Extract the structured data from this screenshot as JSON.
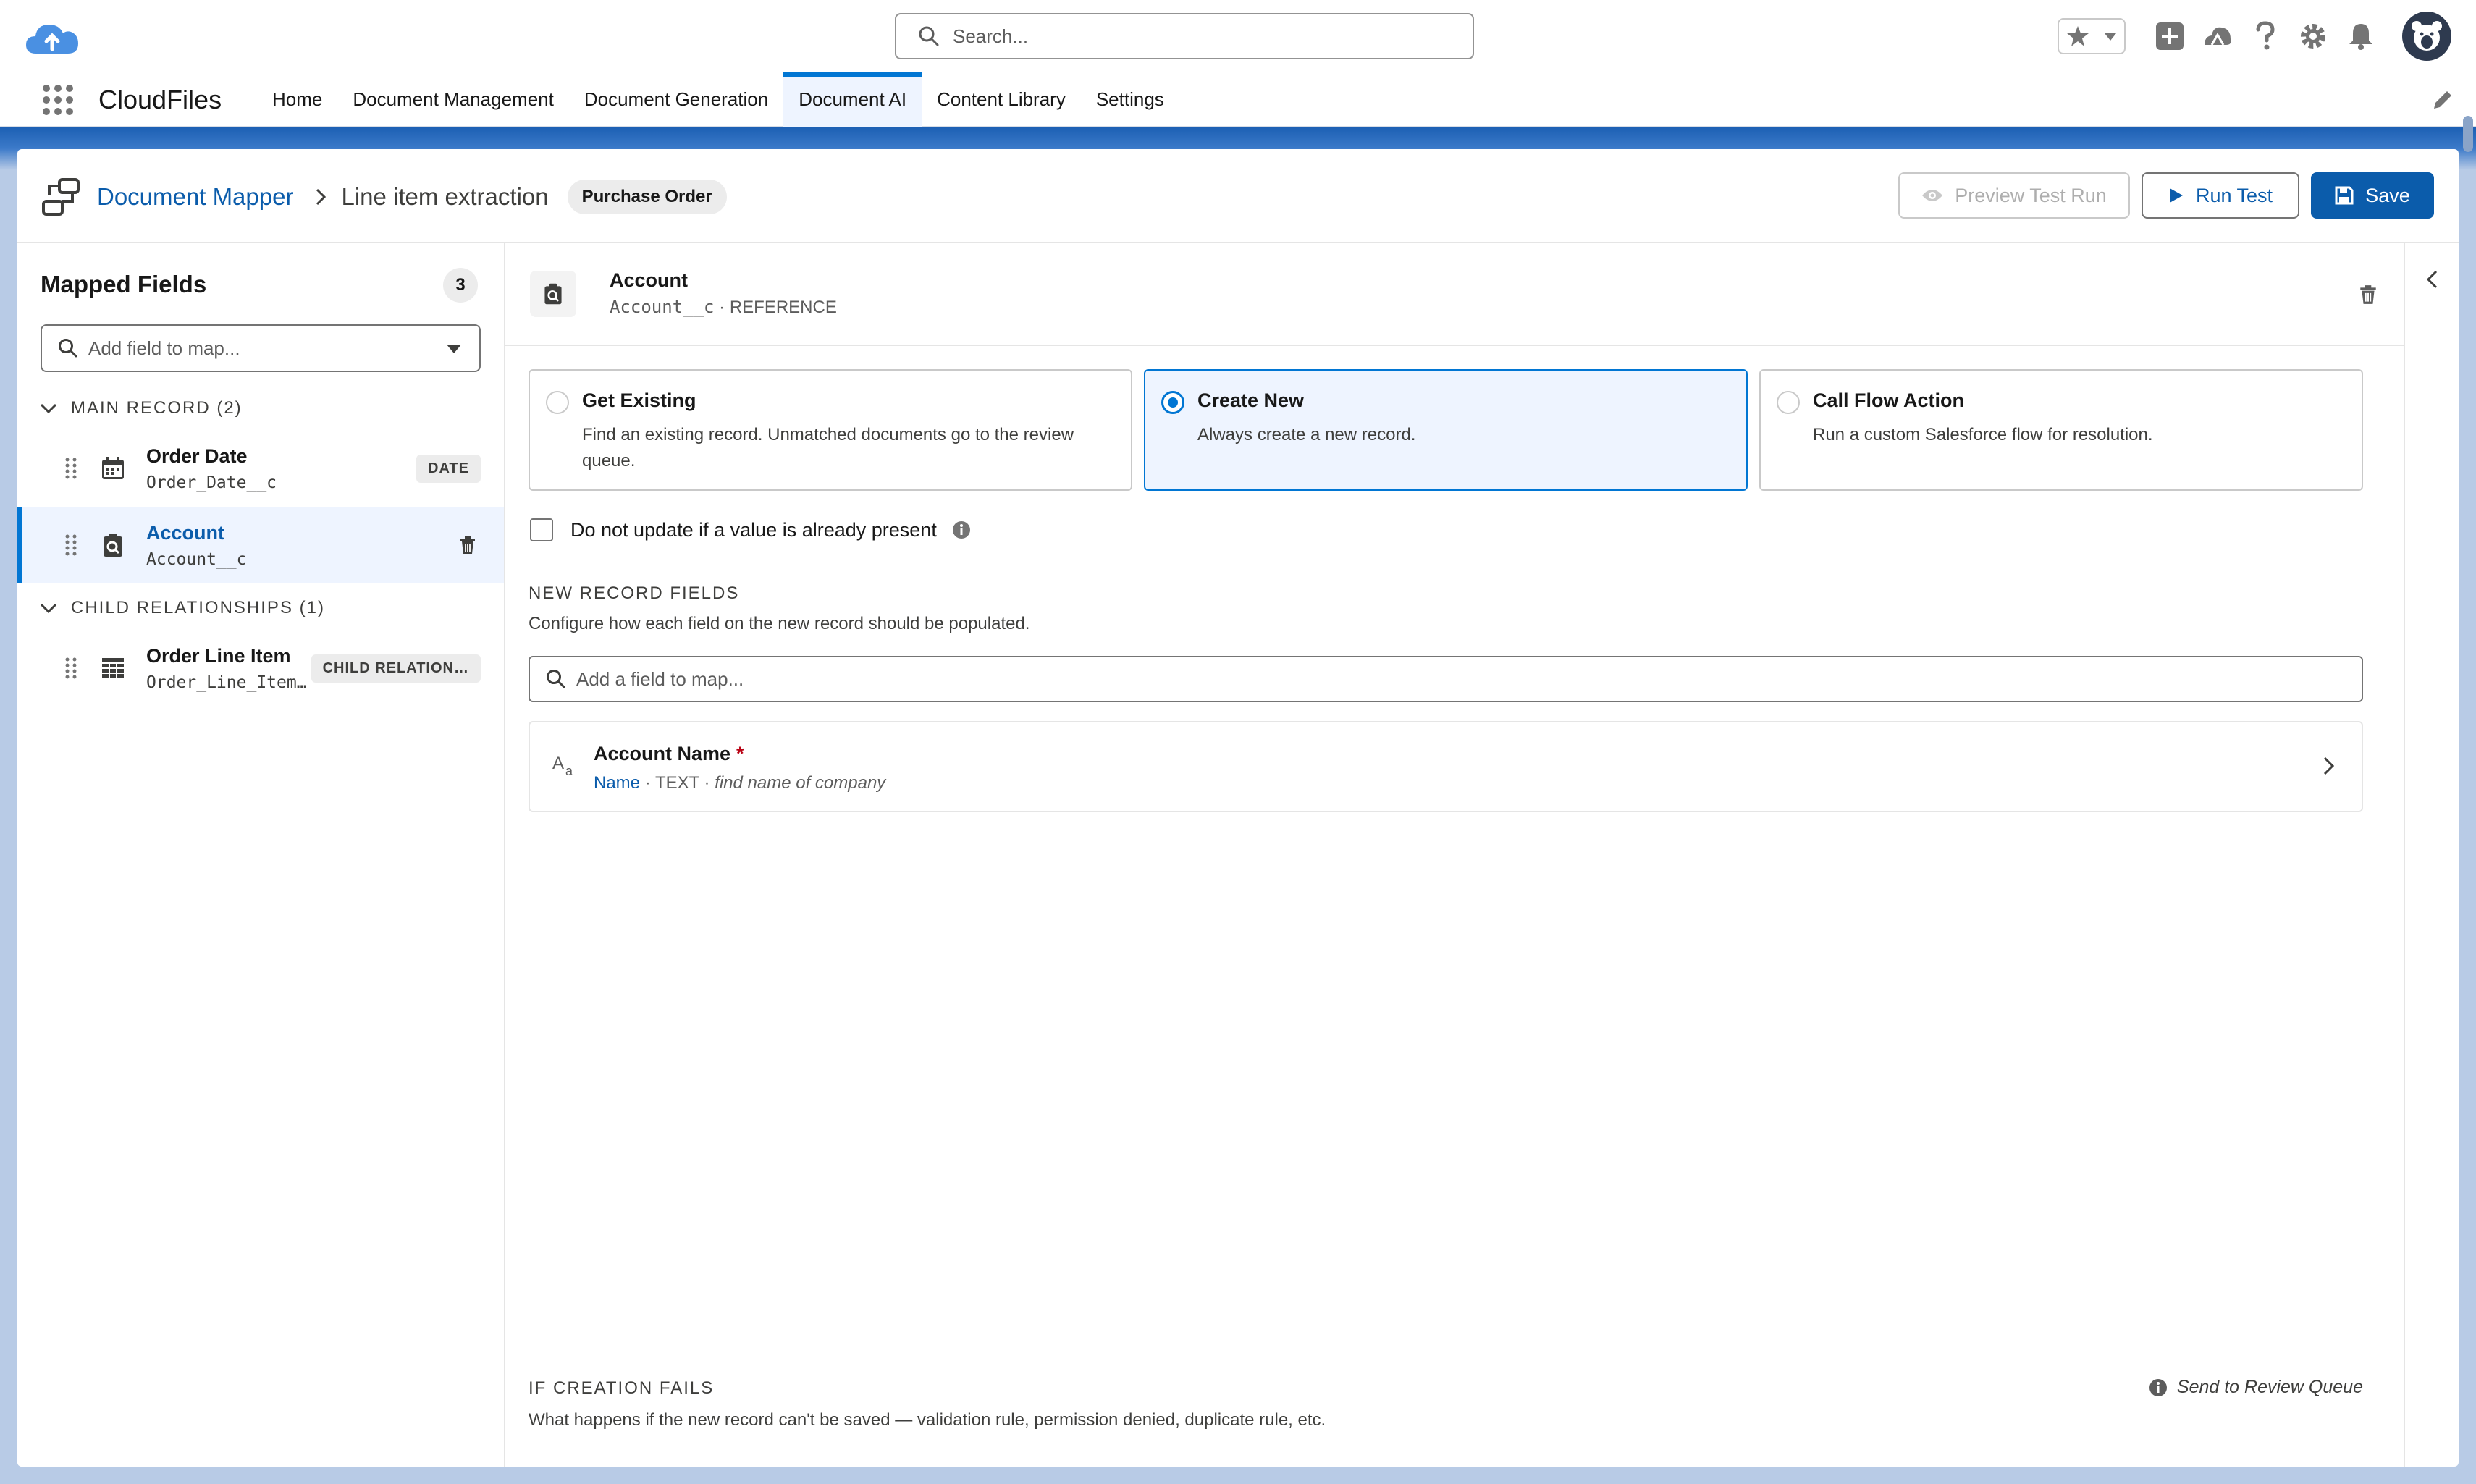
{
  "header": {
    "search_placeholder": "Search...",
    "icons": [
      "favorites-star-icon",
      "favorites-dropdown-icon",
      "global-add-icon",
      "trailhead-icon",
      "help-icon",
      "setup-gear-icon",
      "notifications-bell-icon",
      "user-avatar"
    ]
  },
  "nav": {
    "app_name": "CloudFiles",
    "items": [
      {
        "label": "Home",
        "active": false
      },
      {
        "label": "Document Management",
        "active": false
      },
      {
        "label": "Document Generation",
        "active": false
      },
      {
        "label": "Document AI",
        "active": true
      },
      {
        "label": "Content Library",
        "active": false
      },
      {
        "label": "Settings",
        "active": false
      }
    ]
  },
  "page": {
    "breadcrumb_root": "Document Mapper",
    "breadcrumb_current": "Line item extraction",
    "doc_type_pill": "Purchase Order",
    "buttons": {
      "preview": "Preview Test Run",
      "run": "Run Test",
      "save": "Save"
    }
  },
  "left_panel": {
    "title": "Mapped Fields",
    "count": "3",
    "search_placeholder": "Add field to map...",
    "sections": [
      {
        "label": "MAIN RECORD (2)",
        "fields": [
          {
            "name": "Order Date",
            "api": "Order_Date__c",
            "badge": "DATE",
            "icon": "calendar-icon",
            "selected": false
          },
          {
            "name": "Account",
            "api": "Account__c",
            "badge": "",
            "icon": "lookup-reference-icon",
            "selected": true
          }
        ]
      },
      {
        "label": "CHILD RELATIONSHIPS (1)",
        "fields": [
          {
            "name": "Order Line Item",
            "api": "Order_Line_Item…",
            "badge": "CHILD RELATION…",
            "icon": "table-grid-icon",
            "selected": false
          }
        ]
      }
    ]
  },
  "detail": {
    "field_name": "Account",
    "field_api": "Account__c",
    "field_meta_sep": " · ",
    "field_type": "REFERENCE",
    "options": [
      {
        "title": "Get Existing",
        "desc": "Find an existing record. Unmatched documents go to the review queue.",
        "selected": false
      },
      {
        "title": "Create New",
        "desc": "Always create a new record.",
        "selected": true
      },
      {
        "title": "Call Flow Action",
        "desc": "Run a custom Salesforce flow for resolution.",
        "selected": false
      }
    ],
    "checkbox_label": "Do not update if a value is already present",
    "checkbox_checked": false,
    "new_record_title": "NEW RECORD FIELDS",
    "new_record_desc": "Configure how each field on the new record should be populated.",
    "new_record_search_placeholder": "Add a field to map...",
    "new_record_fields": [
      {
        "name": "Account Name",
        "required_mark": "*",
        "api": "Name",
        "sep1": " · ",
        "type": "TEXT",
        "sep2": " · ",
        "hint": "find name of company"
      }
    ],
    "fail_title": "IF CREATION FAILS",
    "fail_desc": "What happens if the new record can't be saved — validation rule, permission denied, duplicate rule, etc.",
    "fail_action": "Send to Review Queue"
  },
  "colors": {
    "brand_blue": "#0176d3",
    "link_blue": "#0b5cab",
    "selected_bg": "#eef4ff",
    "required_red": "#ba0517"
  }
}
